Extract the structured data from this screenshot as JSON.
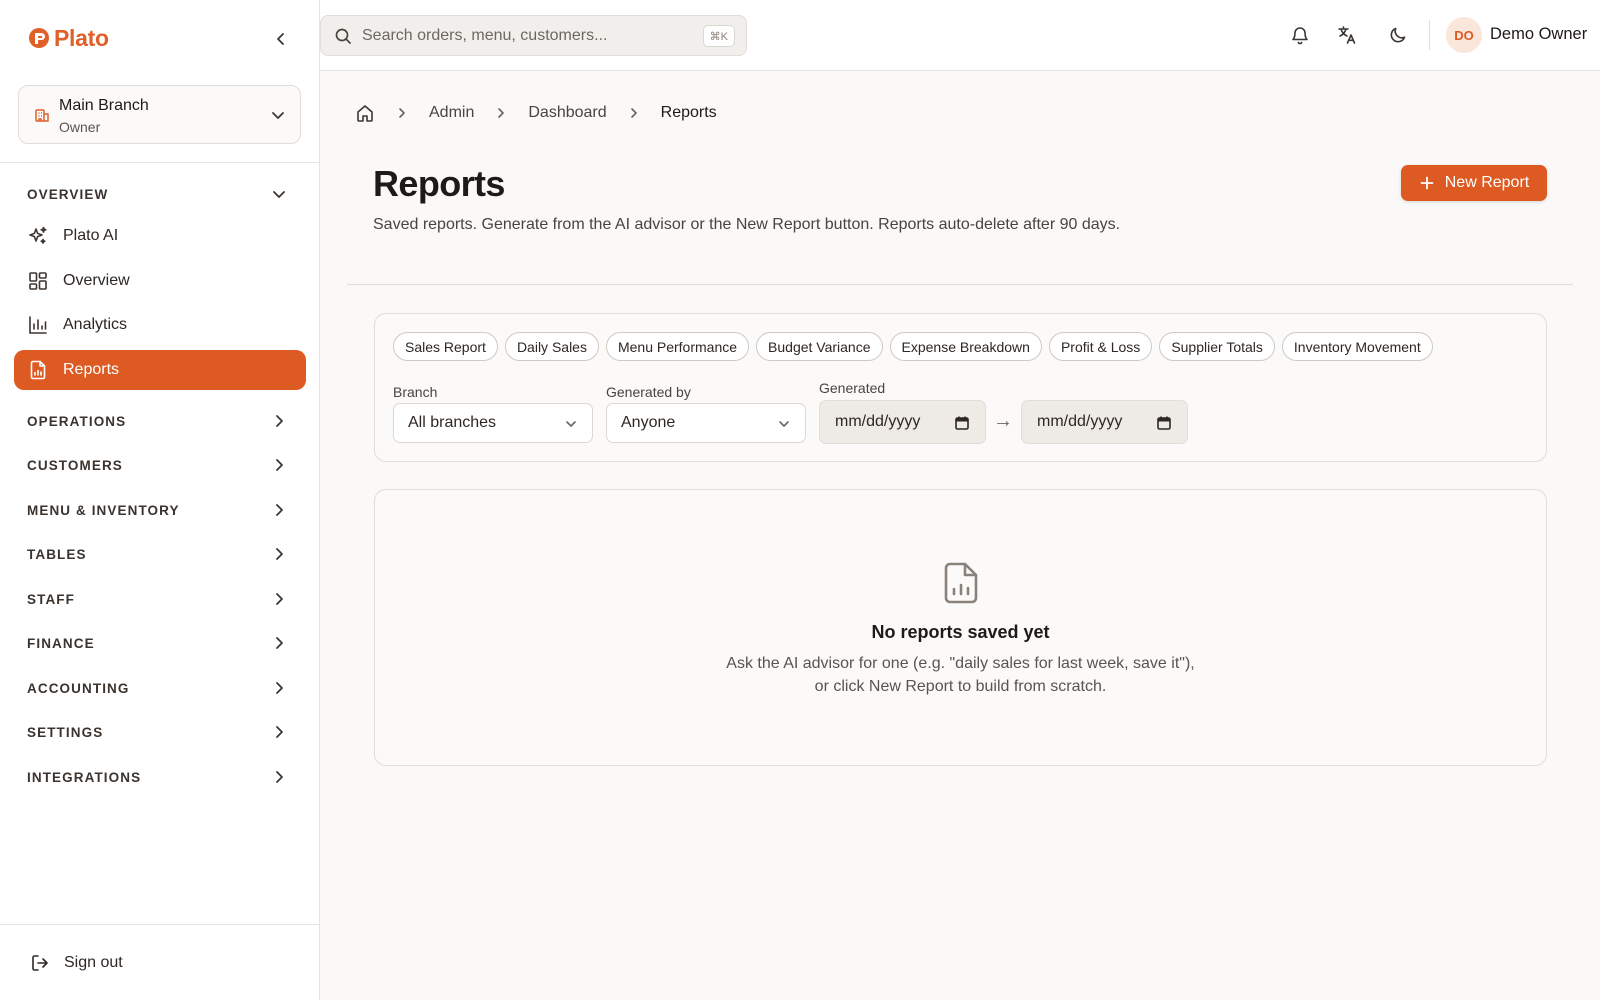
{
  "app": {
    "name": "Plato"
  },
  "branch": {
    "name": "Main Branch",
    "role": "Owner"
  },
  "sidebar": {
    "overview_label": "OVERVIEW",
    "items": [
      {
        "label": "Plato AI",
        "icon": "sparkles-icon"
      },
      {
        "label": "Overview",
        "icon": "grid-icon"
      },
      {
        "label": "Analytics",
        "icon": "bar-chart-icon"
      },
      {
        "label": "Reports",
        "icon": "file-chart-icon",
        "active": true
      }
    ],
    "sections": [
      "OPERATIONS",
      "CUSTOMERS",
      "MENU & INVENTORY",
      "TABLES",
      "STAFF",
      "FINANCE",
      "ACCOUNTING",
      "SETTINGS",
      "INTEGRATIONS"
    ],
    "sign_out": "Sign out"
  },
  "topbar": {
    "search_placeholder": "Search orders, menu, customers...",
    "shortcut": "⌘K",
    "user_initials": "DO",
    "user_name": "Demo Owner"
  },
  "breadcrumb": [
    "Admin",
    "Dashboard",
    "Reports"
  ],
  "page": {
    "title": "Reports",
    "subtitle": "Saved reports. Generate from the AI advisor or the New Report button. Reports auto-delete after 90 days.",
    "new_button": "New Report"
  },
  "filters": {
    "chips": [
      "Sales Report",
      "Daily Sales",
      "Menu Performance",
      "Budget Variance",
      "Expense Breakdown",
      "Profit & Loss",
      "Supplier Totals",
      "Inventory Movement"
    ],
    "branch_label": "Branch",
    "branch_value": "All branches",
    "generated_by_label": "Generated by",
    "generated_by_value": "Anyone",
    "generated_label": "Generated",
    "date_from": "mm/dd/yyyy",
    "date_to": "mm/dd/yyyy",
    "range_arrow": "→"
  },
  "empty": {
    "title": "No reports saved yet",
    "line1": "Ask the AI advisor for one (e.g. \"daily sales for last week, save it\"),",
    "line2": "or click New Report to build from scratch."
  },
  "colors": {
    "accent": "#dd5a22",
    "background": "#faf9f7"
  }
}
